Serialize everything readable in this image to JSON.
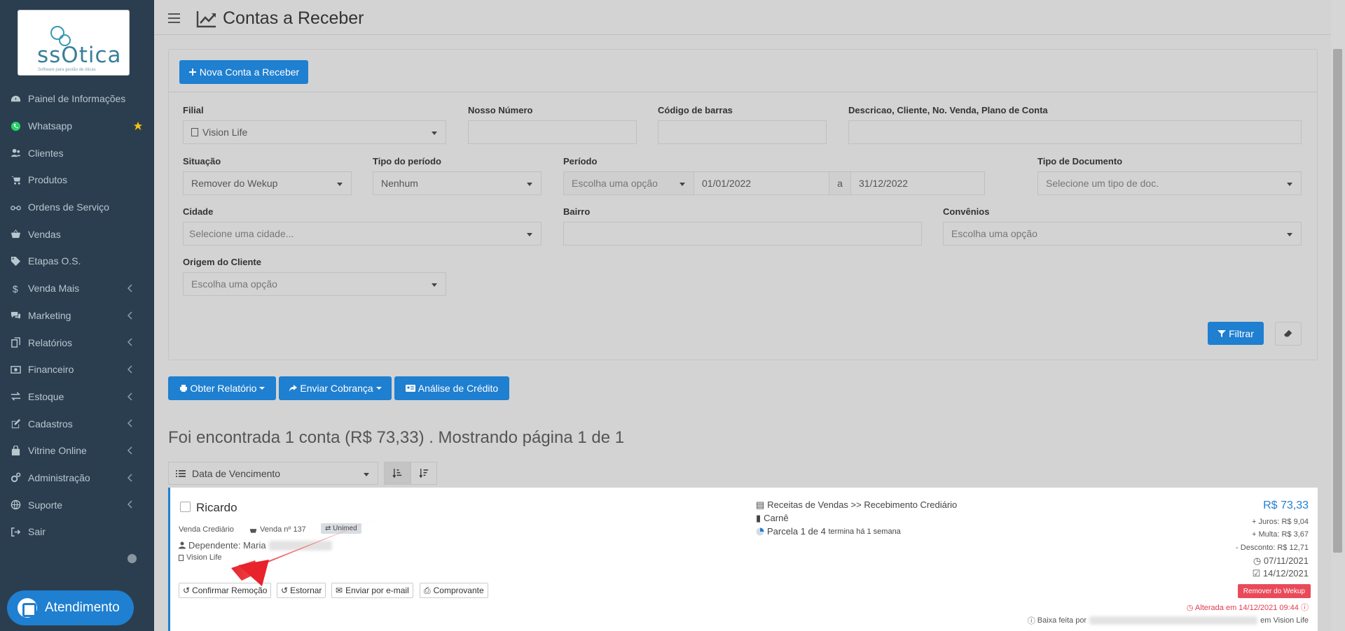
{
  "brand": {
    "logo_text": "ssOtica",
    "logo_sub": "Software para gestão de óticas"
  },
  "menu": [
    {
      "label": "Painel de Informações",
      "icon": "dashboard-icon",
      "chevron": false
    },
    {
      "label": "Whatsapp",
      "icon": "whatsapp-icon",
      "chevron": false,
      "star": true
    },
    {
      "label": "Clientes",
      "icon": "users-icon",
      "chevron": false
    },
    {
      "label": "Produtos",
      "icon": "cart-icon",
      "chevron": false
    },
    {
      "label": "Ordens de Serviço",
      "icon": "glasses-icon",
      "chevron": false
    },
    {
      "label": "Vendas",
      "icon": "basket-icon",
      "chevron": false
    },
    {
      "label": "Etapas O.S.",
      "icon": "tag-icon",
      "chevron": false
    },
    {
      "label": "Venda Mais",
      "icon": "dollar-icon",
      "chevron": true
    },
    {
      "label": "Marketing",
      "icon": "comments-icon",
      "chevron": true
    },
    {
      "label": "Relatórios",
      "icon": "copy-icon",
      "chevron": true
    },
    {
      "label": "Financeiro",
      "icon": "money-icon",
      "chevron": true
    },
    {
      "label": "Estoque",
      "icon": "exchange-icon",
      "chevron": true
    },
    {
      "label": "Cadastros",
      "icon": "edit-icon",
      "chevron": true
    },
    {
      "label": "Vitrine Online",
      "icon": "shopping-bag-icon",
      "chevron": true
    },
    {
      "label": "Administração",
      "icon": "cogs-icon",
      "chevron": true
    },
    {
      "label": "Suporte",
      "icon": "globe-icon",
      "chevron": true
    },
    {
      "label": "Sair",
      "icon": "sign-out-icon",
      "chevron": false
    }
  ],
  "chat_label": "Atendimento",
  "page_title": "Contas a Receber",
  "new_button": "Nova Conta a Receber",
  "filters": {
    "filial_label": "Filial",
    "filial_value": "Vision Life",
    "nosso_label": "Nosso Número",
    "codigo_label": "Código de barras",
    "descricao_label": "Descricao, Cliente, No. Venda, Plano de Conta",
    "situacao_label": "Situação",
    "situacao_value": "Remover do Wekup",
    "tipo_periodo_label": "Tipo do período",
    "tipo_periodo_value": "Nenhum",
    "periodo_label": "Período",
    "periodo_option": "Escolha uma opção",
    "date_from": "01/01/2022",
    "date_sep": "a",
    "date_to": "31/12/2022",
    "tipo_doc_label": "Tipo de Documento",
    "tipo_doc_placeholder": "Selecione um tipo de doc.",
    "cidade_label": "Cidade",
    "cidade_placeholder": "Selecione uma cidade...",
    "bairro_label": "Bairro",
    "convenios_label": "Convênios",
    "convenios_placeholder": "Escolha uma opção",
    "origem_label": "Origem do Cliente",
    "origem_placeholder": "Escolha uma opção",
    "filtrar": "Filtrar"
  },
  "actions": {
    "relatorio": "Obter Relatório",
    "cobranca": "Enviar Cobrança",
    "analise": "Análise de Crédito"
  },
  "result_text": "Foi encontrada 1 conta (R$ 73,33) . Mostrando página 1 de 1",
  "sort_label": "Data de Vencimento",
  "card": {
    "name": "Ricardo",
    "tipo": "Venda Crediário",
    "venda": "Venda nº 137",
    "convenio": "Unimed",
    "dependente": "Dependente: Maria",
    "filial": "Vision Life",
    "receita": "Receitas de Vendas >> Recebimento Crediário",
    "documento": "Carnê",
    "parcela": "Parcela 1 de 4",
    "parcela_note": "termina há 1 semana",
    "valor": "R$ 73,33",
    "juros": "+ Juros: R$ 9,04",
    "multa": "+ Multa: R$ 3,67",
    "desconto": "- Desconto: R$ 12,71",
    "vencimento": "07/11/2021",
    "pagamento": "14/12/2021",
    "status": "Remover do Wekup",
    "alterada": "Alterada em 14/12/2021 09:44",
    "baixa_prefix": "Baixa feita por",
    "baixa_suffix": "em Vision Life",
    "btn_confirmar": "Confirmar Remoção",
    "btn_estornar": "Estornar",
    "btn_email": "Enviar por e-mail",
    "btn_comprovante": "Comprovante"
  },
  "colors": {
    "sidebar": "#2b3e50",
    "primary": "#1f7fd0",
    "danger": "#e94a5a",
    "arrow": "#e8232b"
  }
}
